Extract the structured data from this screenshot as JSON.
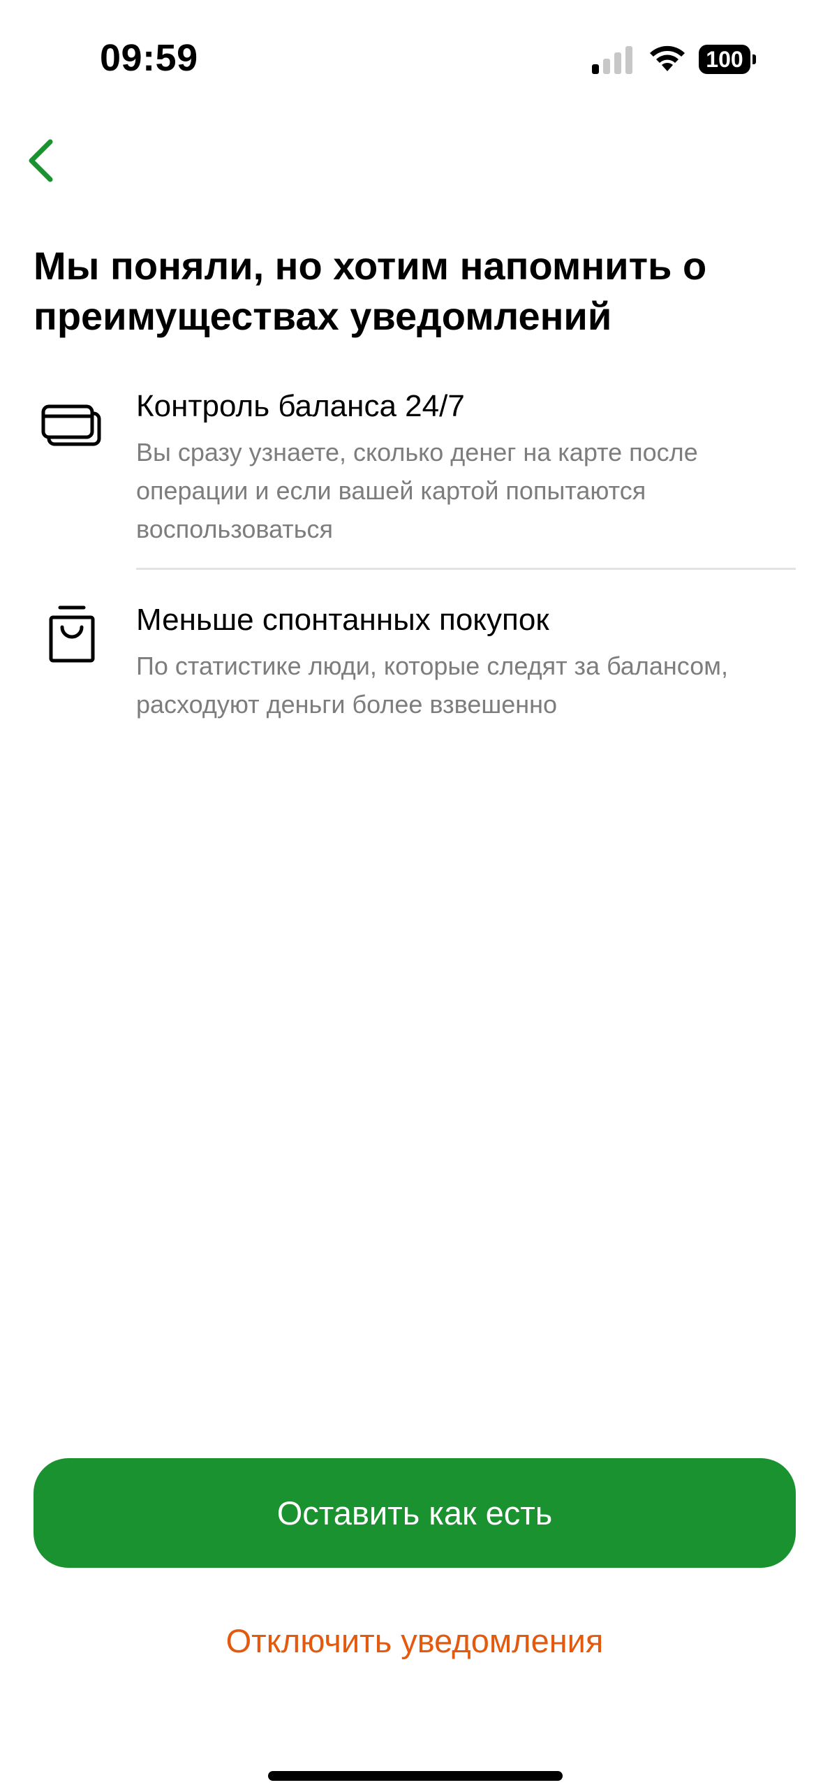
{
  "status_bar": {
    "time": "09:59",
    "battery_level": "100",
    "icons": [
      "signal-icon",
      "wifi-icon",
      "battery-icon"
    ]
  },
  "nav": {
    "back_icon": "chevron-left-icon",
    "accent_color": "#1a9230"
  },
  "title": "Мы поняли, но хотим напомнить о преимуществах уведомлений",
  "benefits": [
    {
      "icon": "cards-icon",
      "title": "Контроль баланса 24/7",
      "description": "Вы сразу узнаете, сколько денег на карте после операции и если вашей картой попытаются воспользоваться"
    },
    {
      "icon": "shopping-bag-icon",
      "title": "Меньше спонтанных покупок",
      "description": "По статистике люди, которые следят за балансом, расходуют деньги более взвешенно"
    }
  ],
  "actions": {
    "primary_label": "Оставить как есть",
    "primary_color": "#1a9230",
    "secondary_label": "Отключить уведомления",
    "secondary_color": "#e35a0f"
  }
}
